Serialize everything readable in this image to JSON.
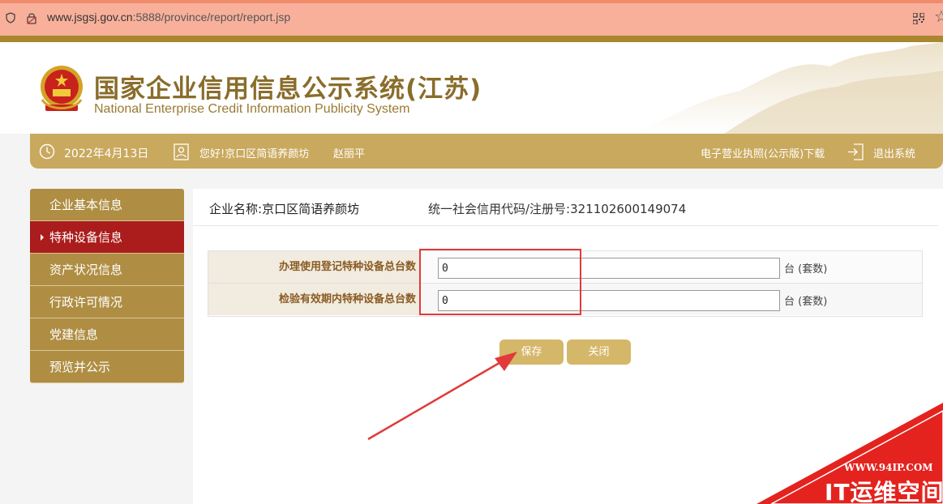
{
  "browser": {
    "url_domain": "www.jsgsj.gov.cn",
    "url_rest": ":5888/province/report/report.jsp"
  },
  "header": {
    "title_cn": "国家企业信用信息公示系统(江苏)",
    "title_en": "National Enterprise Credit Information Publicity System"
  },
  "infobar": {
    "date": "2022年4月13日",
    "greeting": "您好!京口区简语养颜坊",
    "user_name": "赵丽平",
    "download_link": "电子营业执照(公示版)下载",
    "logout_link": "退出系统"
  },
  "sidebar": {
    "items": [
      {
        "label": "企业基本信息",
        "active": false
      },
      {
        "label": "特种设备信息",
        "active": true
      },
      {
        "label": "资产状况信息",
        "active": false
      },
      {
        "label": "行政许可情况",
        "active": false
      },
      {
        "label": "党建信息",
        "active": false
      },
      {
        "label": "预览并公示",
        "active": false
      }
    ]
  },
  "main": {
    "enterprise_name_label": "企业名称:",
    "enterprise_name": "京口区简语养颜坊",
    "credit_code_label": "统一社会信用代码/注册号:",
    "credit_code": "321102600149074",
    "rows": [
      {
        "label": "办理使用登记特种设备总台数",
        "value": "0",
        "unit": "台 (套数)"
      },
      {
        "label": "检验有效期内特种设备总台数",
        "value": "0",
        "unit": "台 (套数)"
      }
    ],
    "save_label": "保存",
    "close_label": "关闭"
  },
  "watermark": {
    "url": "WWW.94IP.COM",
    "text": "IT运维空间"
  },
  "colors": {
    "gold": "#c9a95e",
    "sidebar": "#af8e43",
    "active": "#ab1c1c",
    "highlight": "#e23a3a"
  }
}
